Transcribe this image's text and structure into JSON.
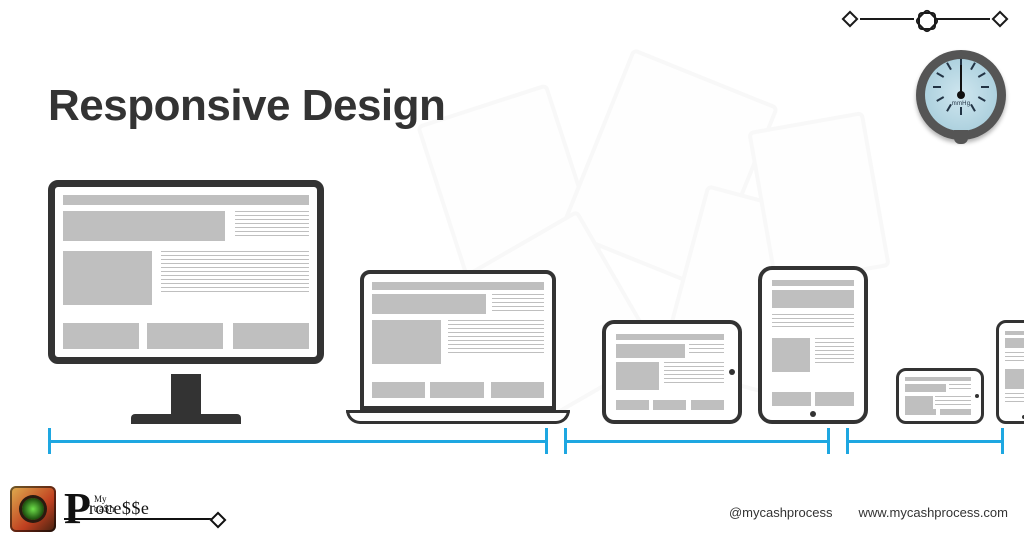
{
  "title": "Responsive Design",
  "gauge": {
    "unit": "mmHg"
  },
  "devices": [
    {
      "id": "desktop",
      "label": "Desktop monitor"
    },
    {
      "id": "laptop",
      "label": "Laptop"
    },
    {
      "id": "tablet-landscape",
      "label": "Tablet (landscape)"
    },
    {
      "id": "tablet-portrait",
      "label": "Tablet (portrait)"
    },
    {
      "id": "phone-landscape",
      "label": "Phone (landscape)"
    },
    {
      "id": "phone-portrait",
      "label": "Phone (portrait)"
    }
  ],
  "breakpoint_groups": [
    {
      "covers": [
        "desktop",
        "laptop"
      ]
    },
    {
      "covers": [
        "tablet-landscape",
        "tablet-portrait"
      ]
    },
    {
      "covers": [
        "phone-landscape",
        "phone-portrait"
      ]
    }
  ],
  "brand": {
    "big_letter": "P",
    "small_line1": "My",
    "small_line2": "ca$h",
    "rest": "roce$$e",
    "handle": "@mycashprocess",
    "url": "www.mycashprocess.com"
  },
  "colors": {
    "accent": "#1ea7e1",
    "device_frame": "#333333",
    "wireframe": "#bfbfbf",
    "text": "#333333"
  }
}
